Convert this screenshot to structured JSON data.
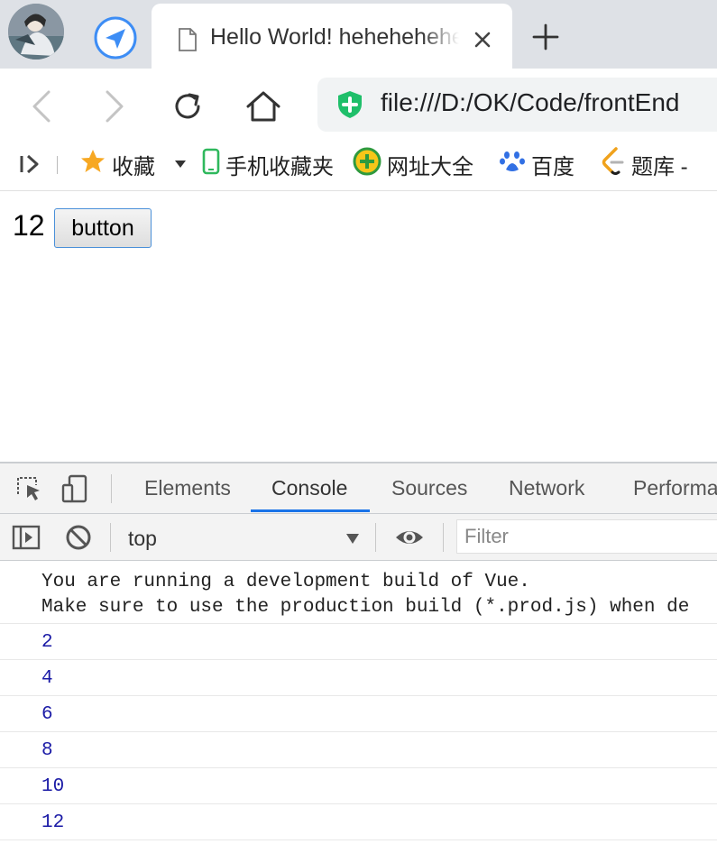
{
  "browser": {
    "tab": {
      "title": "Hello World! hehehehehe"
    },
    "address": "file:///D:/OK/Code/frontEnd"
  },
  "bookmarks": [
    {
      "label": "收藏",
      "icon": "star-icon"
    },
    {
      "label": "手机收藏夹",
      "icon": "phone-icon"
    },
    {
      "label": "网址大全",
      "icon": "plus-circle-icon"
    },
    {
      "label": "百度",
      "icon": "paw-icon"
    },
    {
      "label": "题库 -",
      "icon": "leetcode-icon"
    }
  ],
  "page": {
    "count": "12",
    "button_label": "button"
  },
  "devtools": {
    "tabs": [
      "Elements",
      "Console",
      "Sources",
      "Network",
      "Performa"
    ],
    "active_tab": "Console",
    "context": "top",
    "filter_placeholder": "Filter",
    "messages": {
      "info": [
        "You are running a development build of Vue.",
        "Make sure to use the production build (*.prod.js) when de"
      ],
      "logs": [
        "2",
        "4",
        "6",
        "8",
        "10",
        "12"
      ]
    }
  },
  "colors": {
    "tab_strip": "#dee1e6",
    "accent_blue": "#1a73e8",
    "log_number": "#1a1aa6",
    "shield_green": "#1fbf6a"
  }
}
